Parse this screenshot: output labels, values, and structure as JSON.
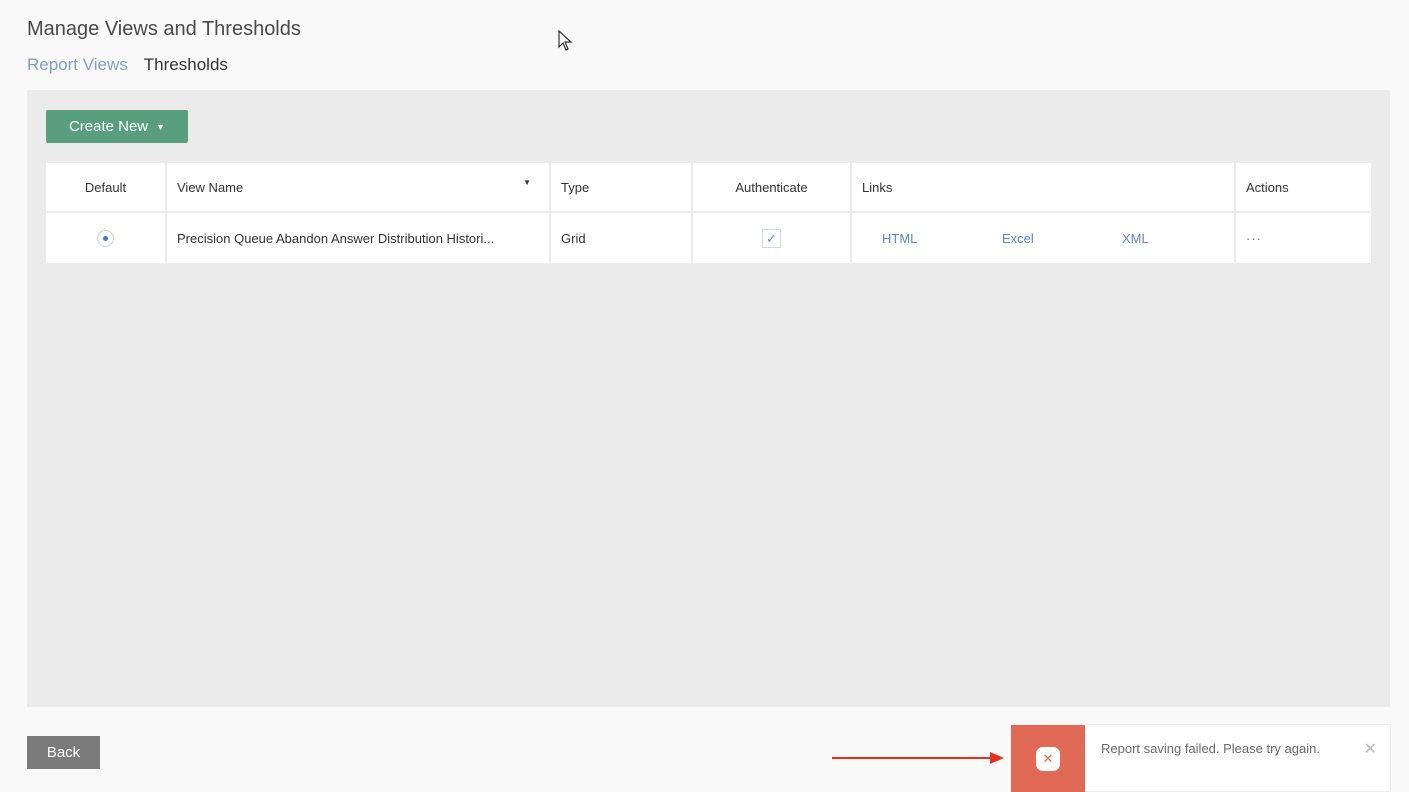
{
  "header": {
    "title": "Manage Views and Thresholds",
    "tabs": [
      {
        "label": "Report Views",
        "active": false
      },
      {
        "label": "Thresholds",
        "active": true
      }
    ]
  },
  "toolbar": {
    "create_label": "Create New",
    "create_icon": "caret-down-icon"
  },
  "table": {
    "columns": [
      "Default",
      "View Name",
      "Type",
      "Authenticate",
      "Links",
      "Actions"
    ],
    "rows": [
      {
        "default_selected": true,
        "view_name": "Precision Queue Abandon Answer Distribution Histori...",
        "type": "Grid",
        "authenticate": true,
        "links": [
          "HTML",
          "Excel",
          "XML"
        ],
        "actions": "···"
      }
    ]
  },
  "footer": {
    "back_label": "Back"
  },
  "toast": {
    "message": "Report saving failed. Please try again.",
    "close_symbol": "✕",
    "icon_symbol": "✕",
    "accent_color": "#e06a55"
  },
  "colors": {
    "primary_button": "#5a9e80",
    "link": "#5b86d6",
    "arrow": "#e8301f"
  }
}
